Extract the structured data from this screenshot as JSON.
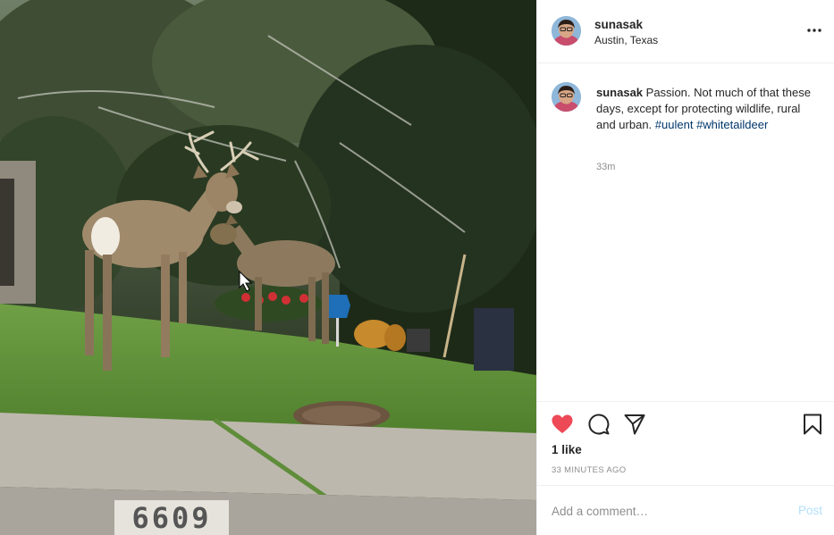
{
  "post": {
    "username": "sunasak",
    "location": "Austin, Texas",
    "caption_user": "sunasak",
    "caption_text": " Passion. Not much of that these days, except for protecting wildlife, rural and urban. ",
    "hashtags": [
      "#uulent",
      "#whitetaildeer"
    ],
    "relative_time": "33m",
    "likes": "1 like",
    "posted_ago": "33 MINUTES AGO"
  },
  "photo": {
    "house_number": "6609"
  },
  "comment": {
    "placeholder": "Add a comment…",
    "post_label": "Post"
  },
  "icons": {
    "more": "more-options-icon",
    "like": "heart-filled-icon",
    "comment": "comment-bubble-icon",
    "share": "paper-plane-icon",
    "save": "bookmark-icon"
  },
  "colors": {
    "like_red": "#ed4956",
    "hashtag_blue": "#00376b",
    "post_disabled": "#b2dffc",
    "muted_text": "#8e8e8e"
  }
}
